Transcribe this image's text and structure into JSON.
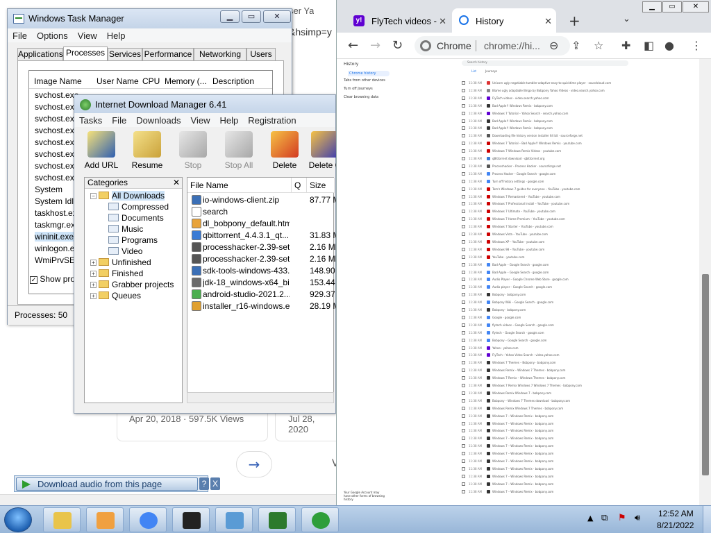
{
  "background_page": {
    "tab_fragment": "ser Ya",
    "url_fragment": "&hsimp=y",
    "card1_meta": "Apr 20, 2018 · 597.5K Views",
    "card2_meta": "Jul 28, 2020",
    "next_arrow": "→",
    "v_fragment": "V",
    "download_audio": "Download audio from this page",
    "help": "?",
    "close": "X"
  },
  "task_manager": {
    "title": "Windows Task Manager",
    "menu": [
      "File",
      "Options",
      "View",
      "Help"
    ],
    "tabs": [
      "Applications",
      "Processes",
      "Services",
      "Performance",
      "Networking",
      "Users"
    ],
    "active_tab": "Processes",
    "columns": [
      "Image Name",
      "User Name",
      "CPU",
      "Memory (...",
      "Description"
    ],
    "processes": [
      "svchost.exe",
      "svchost.exe",
      "svchost.exe",
      "svchost.exe",
      "svchost.exe",
      "svchost.exe",
      "svchost.exe",
      "svchost.exe",
      "System",
      "System Idle",
      "taskhost.exe",
      "taskmgr.exe",
      "wininit.exe",
      "winlogon.exe",
      "WmiPrvSE.exe"
    ],
    "selected_process": "wininit.exe",
    "show_processes": "Show proc",
    "status": "Processes: 50"
  },
  "idm": {
    "title": "Internet Download Manager 6.41",
    "menu": [
      "Tasks",
      "File",
      "Downloads",
      "View",
      "Help",
      "Registration"
    ],
    "toolbar": [
      {
        "label": "Add URL",
        "icon": "add-url-icon",
        "enabled": true
      },
      {
        "label": "Resume",
        "icon": "resume-icon",
        "enabled": true
      },
      {
        "label": "Stop",
        "icon": "stop-icon",
        "enabled": false
      },
      {
        "label": "Stop All",
        "icon": "stop-all-icon",
        "enabled": false
      },
      {
        "label": "Delete",
        "icon": "delete-icon",
        "enabled": true
      },
      {
        "label": "Delete C",
        "icon": "delete-completed-icon",
        "enabled": true
      }
    ],
    "categories_header": "Categories",
    "categories_close": "✕",
    "categories": [
      {
        "label": "All Downloads",
        "level": 0,
        "expanded": true
      },
      {
        "label": "Compressed",
        "level": 1
      },
      {
        "label": "Documents",
        "level": 1
      },
      {
        "label": "Music",
        "level": 1
      },
      {
        "label": "Programs",
        "level": 1
      },
      {
        "label": "Video",
        "level": 1
      },
      {
        "label": "Unfinished",
        "level": 0
      },
      {
        "label": "Finished",
        "level": 0
      },
      {
        "label": "Grabber projects",
        "level": 0
      },
      {
        "label": "Queues",
        "level": 0
      }
    ],
    "file_columns": [
      "File Name",
      "Q",
      "Size"
    ],
    "files": [
      {
        "name": "io-windows-client.zip",
        "size": "87.77  M",
        "color": "#3b6fb6"
      },
      {
        "name": "search",
        "size": "",
        "color": "#ffffff"
      },
      {
        "name": "dl_bobpony_default.html",
        "size": "",
        "color": "#e8a33a"
      },
      {
        "name": "qbittorrent_4.4.3.1_qt...",
        "size": "31.83  M",
        "color": "#3a7bd5"
      },
      {
        "name": "processhacker-2.39-set...",
        "size": "2.16  ME",
        "color": "#555555"
      },
      {
        "name": "processhacker-2.39-set...",
        "size": "2.16  ME",
        "color": "#555555"
      },
      {
        "name": "sdk-tools-windows-433...",
        "size": "148.90",
        "color": "#3b6fb6"
      },
      {
        "name": "jdk-18_windows-x64_bi...",
        "size": "153.44",
        "color": "#6a6a6a"
      },
      {
        "name": "android-studio-2021.2....",
        "size": "929.37",
        "color": "#4caf50"
      },
      {
        "name": "installer_r16-windows.exe",
        "size": "28.19  M",
        "color": "#e0a030"
      }
    ]
  },
  "chrome": {
    "tabs": [
      {
        "title": "FlyTech videos -",
        "icon": "yahoo-icon"
      },
      {
        "title": "History",
        "icon": "history-icon"
      }
    ],
    "new_tab": "+",
    "omnibox_label": "Chrome",
    "omnibox_url": "chrome://hi...",
    "history_sidebar": [
      "History",
      "Chrome history",
      "Tabs from other devices",
      "Turn off Journeys",
      "Clear browsing data"
    ],
    "search_placeholder": "Search history",
    "history_tabs": [
      "List",
      "Journeys"
    ],
    "history_rows": [
      {
        "time": "11:38 AM",
        "text": "Unicorn ugly negotiable tumbler-adaptive-easy-to-quicktime player  · soundcloud.com",
        "color": "#d33"
      },
      {
        "time": "11:38 AM",
        "text": "Blame ugly adaptable Bingo by Bobpony Yahoo Videos  · video.search.yahoo.com",
        "color": "#888"
      },
      {
        "time": "11:38 AM",
        "text": "FlyTech videos  · video.search.yahoo.com",
        "color": "#6001d2"
      },
      {
        "time": "11:38 AM",
        "text": "Bad Apple!! Windows Remix  · bobpony.com",
        "color": "#333"
      },
      {
        "time": "11:38 AM",
        "text": "Windows 7 Tutorial – Yahoo Search  · search.yahoo.com",
        "color": "#6001d2"
      },
      {
        "time": "11:38 AM",
        "text": "Bad Apple!! Windows Remix  · bobpony.com",
        "color": "#333"
      },
      {
        "time": "11:38 AM",
        "text": "Bad Apple!! Windows Remix  · bobpony.com",
        "color": "#333"
      },
      {
        "time": "11:38 AM",
        "text": "Downloading file history version installer 64 bit  · sourceforge.net",
        "color": "#555"
      },
      {
        "time": "11:38 AM",
        "text": "Windows 7 Tutorial – Bad Apple!! Windows Remix  · youtube.com",
        "color": "#c00"
      },
      {
        "time": "11:38 AM",
        "text": "Windows 7 Windows Remix Videos  · youtube.com",
        "color": "#c00"
      },
      {
        "time": "11:38 AM",
        "text": "qBittorrent download  · qbittorrent.org",
        "color": "#3a7bd5"
      },
      {
        "time": "11:38 AM",
        "text": "Processhacker – Process Hacker  · sourceforge.net",
        "color": "#555"
      },
      {
        "time": "11:38 AM",
        "text": "Process Hacker – Google Search  · google.com",
        "color": "#4285f4"
      },
      {
        "time": "11:38 AM",
        "text": "Turn off history settings  · google.com",
        "color": "#4285f4"
      },
      {
        "time": "11:38 AM",
        "text": "Tom's Windows 7 guides for everyone – YouTube  · youtube.com",
        "color": "#c00"
      },
      {
        "time": "11:38 AM",
        "text": "Windows 7 Remastered – YouTube  · youtube.com",
        "color": "#c00"
      },
      {
        "time": "11:38 AM",
        "text": "Windows 7 Professional Install – YouTube  · youtube.com",
        "color": "#c00"
      },
      {
        "time": "11:38 AM",
        "text": "Windows 7 Ultimate – YouTube  · youtube.com",
        "color": "#c00"
      },
      {
        "time": "11:38 AM",
        "text": "Windows 7 Home Premium – YouTube  · youtube.com",
        "color": "#c00"
      },
      {
        "time": "11:38 AM",
        "text": "Windows 7 Starter – YouTube  · youtube.com",
        "color": "#c00"
      },
      {
        "time": "11:38 AM",
        "text": "Windows Vista – YouTube  · youtube.com",
        "color": "#c00"
      },
      {
        "time": "11:38 AM",
        "text": "Windows XP – YouTube  · youtube.com",
        "color": "#c00"
      },
      {
        "time": "11:38 AM",
        "text": "Windows 98 – YouTube  · youtube.com",
        "color": "#c00"
      },
      {
        "time": "11:38 AM",
        "text": "YouTube  · youtube.com",
        "color": "#c00"
      },
      {
        "time": "11:38 AM",
        "text": "Bad Apple – Google Search  · google.com",
        "color": "#4285f4"
      },
      {
        "time": "11:38 AM",
        "text": "Bad Apple – Google Search  · google.com",
        "color": "#4285f4"
      },
      {
        "time": "11:38 AM",
        "text": "Audio Player – Google Chrome Web Store  · google.com",
        "color": "#4285f4"
      },
      {
        "time": "11:38 AM",
        "text": "Audio player – Google Search  · google.com",
        "color": "#4285f4"
      },
      {
        "time": "11:38 AM",
        "text": "Bobpony  · bobpony.com",
        "color": "#333"
      },
      {
        "time": "11:38 AM",
        "text": "Bobpony Wiki – Google Search  · google.com",
        "color": "#4285f4"
      },
      {
        "time": "11:38 AM",
        "text": "Bobpony  · bobpony.com",
        "color": "#333"
      },
      {
        "time": "11:38 AM",
        "text": "Google  · google.com",
        "color": "#4285f4"
      },
      {
        "time": "11:38 AM",
        "text": "flytech videos – Google Search  · google.com",
        "color": "#4285f4"
      },
      {
        "time": "11:38 AM",
        "text": "flytech – Google Search  · google.com",
        "color": "#4285f4"
      },
      {
        "time": "11:38 AM",
        "text": "Bobpony – Google Search  · google.com",
        "color": "#4285f4"
      },
      {
        "time": "11:38 AM",
        "text": "Yahoo  · yahoo.com",
        "color": "#6001d2"
      },
      {
        "time": "11:38 AM",
        "text": "FlyTech – Yahoo Video Search  · video.yahoo.com",
        "color": "#6001d2"
      },
      {
        "time": "11:38 AM",
        "text": "Windows 7 Themes – Bobpony  · bobpony.com",
        "color": "#333"
      },
      {
        "time": "11:38 AM",
        "text": "Windows Remix – Windows 7 Themes  · bobpony.com",
        "color": "#333"
      },
      {
        "time": "11:38 AM",
        "text": "Windows 7 Remix – Windows Themes  · bobpony.com",
        "color": "#333"
      },
      {
        "time": "11:38 AM",
        "text": "Windows 7 Remix Windows 7 Windows 7 Themes  · bobpony.com",
        "color": "#333"
      },
      {
        "time": "11:38 AM",
        "text": "Windows Remix Windows 7  · bobpony.com",
        "color": "#333"
      },
      {
        "time": "11:38 AM",
        "text": "Bobpony – Windows 7 Themes download  · bobpony.com",
        "color": "#333"
      },
      {
        "time": "11:38 AM",
        "text": "Windows Remix Windows 7 Themes  · bobpony.com",
        "color": "#333"
      },
      {
        "time": "11:38 AM",
        "text": "Windows 7 – Windows Remix  · bobpony.com",
        "color": "#333"
      },
      {
        "time": "11:38 AM",
        "text": "Windows 7 – Windows Remix  · bobpony.com",
        "color": "#333"
      },
      {
        "time": "11:38 AM",
        "text": "Windows 7 – Windows Remix  · bobpony.com",
        "color": "#333"
      },
      {
        "time": "11:38 AM",
        "text": "Windows 7 – Windows Remix  · bobpony.com",
        "color": "#333"
      },
      {
        "time": "11:38 AM",
        "text": "Windows 7 – Windows Remix  · bobpony.com",
        "color": "#333"
      },
      {
        "time": "11:38 AM",
        "text": "Windows 7 – Windows Remix  · bobpony.com",
        "color": "#333"
      },
      {
        "time": "11:38 AM",
        "text": "Windows 7 – Windows Remix  · bobpony.com",
        "color": "#333"
      },
      {
        "time": "11:38 AM",
        "text": "Windows 7 – Windows Remix  · bobpony.com",
        "color": "#333"
      },
      {
        "time": "11:38 AM",
        "text": "Windows 7 – Windows Remix  · bobpony.com",
        "color": "#333"
      },
      {
        "time": "11:38 AM",
        "text": "Windows 7 – Windows Remix  · bobpony.com",
        "color": "#333"
      },
      {
        "time": "11:38 AM",
        "text": "Windows 7 – Windows Remix  · bobpony.com",
        "color": "#333"
      }
    ],
    "footer_note": "Your Google Account may have other forms of browsing history"
  },
  "taskbar": {
    "apps": [
      {
        "name": "explorer",
        "icon": "folder-icon"
      },
      {
        "name": "media-player",
        "icon": "media-player-icon"
      },
      {
        "name": "chrome",
        "icon": "chrome-icon"
      },
      {
        "name": "7zip",
        "icon": "7zip-icon"
      },
      {
        "name": "photo-viewer",
        "icon": "photo-viewer-icon"
      },
      {
        "name": "task-manager",
        "icon": "task-manager-icon"
      },
      {
        "name": "idm",
        "icon": "idm-icon"
      }
    ],
    "time": "12:52 AM",
    "date": "8/21/2022"
  }
}
